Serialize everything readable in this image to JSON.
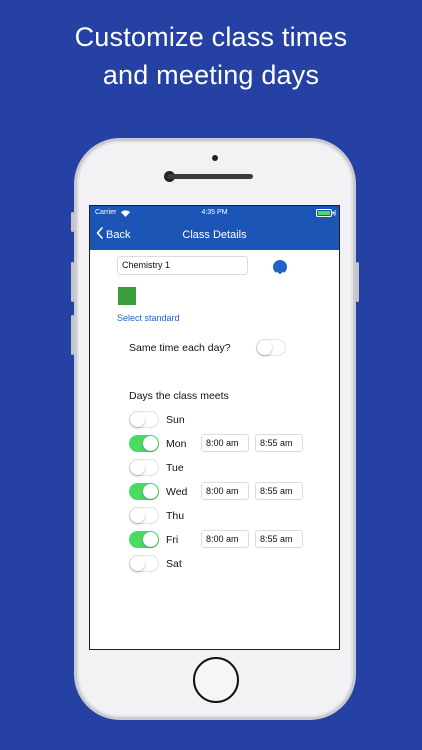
{
  "headline": {
    "line1": "Customize class times",
    "line2": "and meeting days"
  },
  "status": {
    "carrier": "Carrier",
    "time": "4:35 PM"
  },
  "nav": {
    "back_label": "Back",
    "title": "Class Details"
  },
  "form": {
    "class_name": "Chemistry 1",
    "class_color": "#3a9f3a",
    "select_standard": "Select standard",
    "same_time_label": "Same time each day?",
    "same_time_on": false,
    "days_title": "Days the class meets"
  },
  "days": [
    {
      "name": "Sun",
      "on": false
    },
    {
      "name": "Mon",
      "on": true,
      "start": "8:00 am",
      "end": "8:55 am"
    },
    {
      "name": "Tue",
      "on": false
    },
    {
      "name": "Wed",
      "on": true,
      "start": "8:00 am",
      "end": "8:55 am"
    },
    {
      "name": "Thu",
      "on": false
    },
    {
      "name": "Fri",
      "on": true,
      "start": "8:00 am",
      "end": "8:55 am"
    },
    {
      "name": "Sat",
      "on": false
    }
  ],
  "colors": {
    "background": "#2441a3",
    "navbar": "#1d55b6",
    "toggle_on": "#4cd964",
    "link": "#1f63c8"
  }
}
